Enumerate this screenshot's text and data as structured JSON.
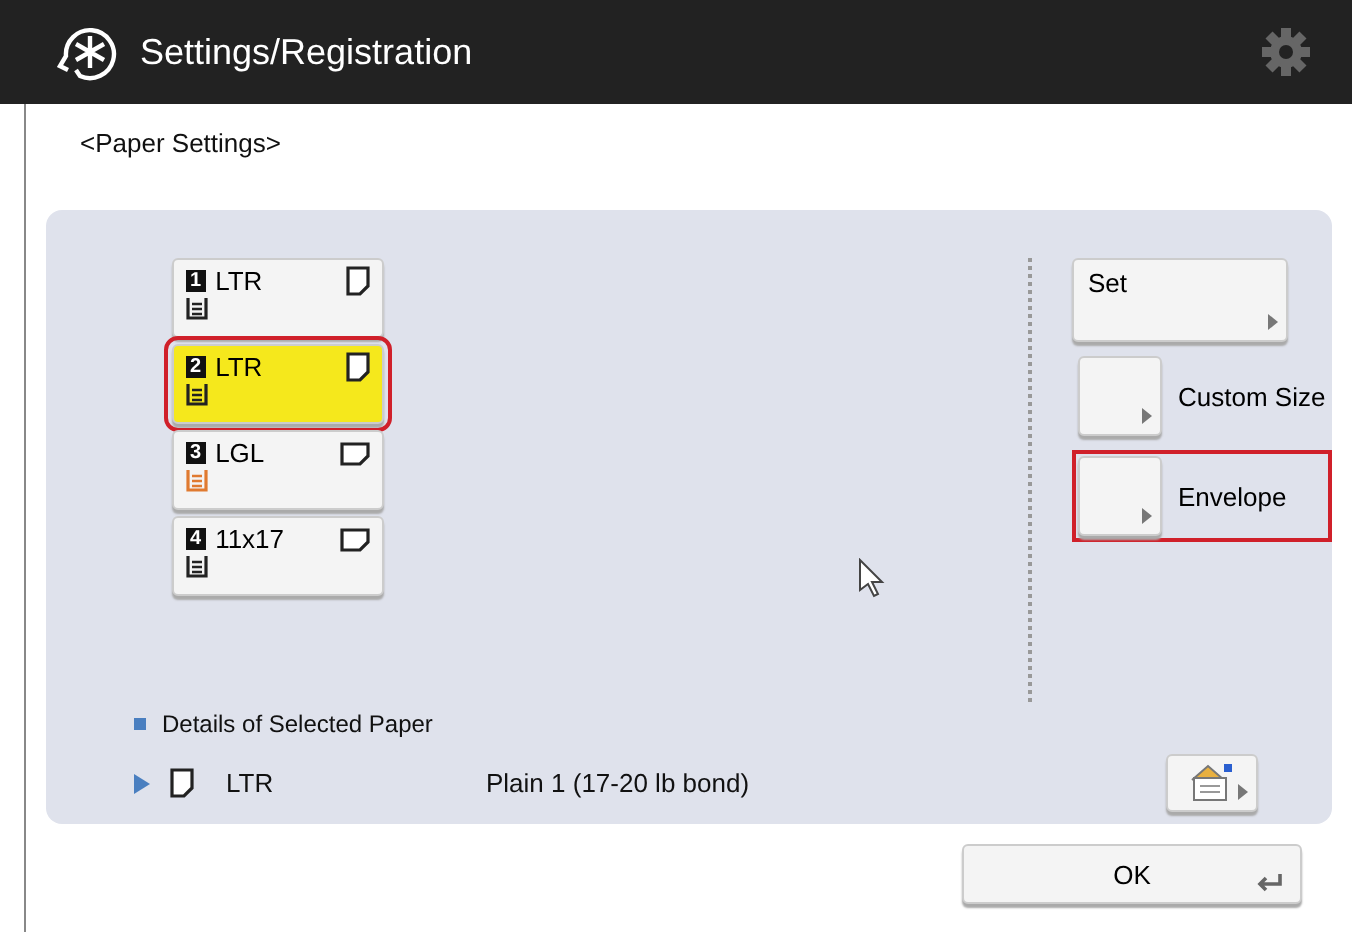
{
  "header": {
    "title": "Settings/Registration"
  },
  "page_title": "<Paper Settings>",
  "drawers": [
    {
      "number": "1",
      "size": "LTR",
      "landscape": false,
      "paper_low": false,
      "selected": false
    },
    {
      "number": "2",
      "size": "LTR",
      "landscape": false,
      "paper_low": false,
      "selected": true
    },
    {
      "number": "3",
      "size": "LGL",
      "landscape": true,
      "paper_low": true,
      "selected": false
    },
    {
      "number": "4",
      "size": "11x17",
      "landscape": true,
      "paper_low": false,
      "selected": false
    }
  ],
  "actions": [
    {
      "kind": "wide",
      "label": "Set",
      "selected": false
    },
    {
      "kind": "side",
      "label": "Custom Size",
      "selected": false
    },
    {
      "kind": "side",
      "label": "Envelope",
      "selected": true
    }
  ],
  "details": {
    "heading": "Details of Selected Paper",
    "size": "LTR",
    "landscape": false,
    "type": "Plain 1 (17-20 lb bond)"
  },
  "ok_button": "OK"
}
